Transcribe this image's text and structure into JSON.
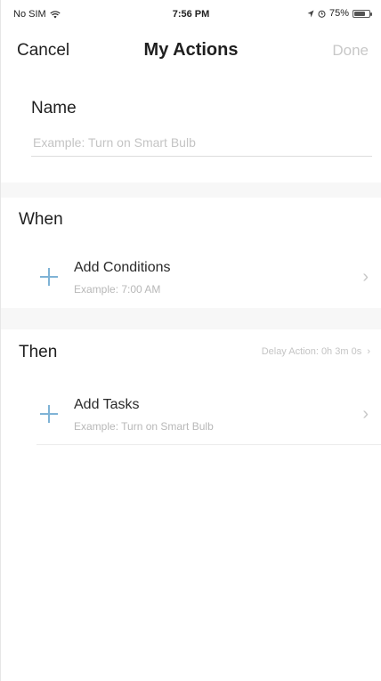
{
  "status_bar": {
    "carrier": "No SIM",
    "time": "7:56 PM",
    "battery_text": "75%",
    "battery_level": 0.75
  },
  "nav": {
    "cancel_label": "Cancel",
    "title": "My Actions",
    "done_label": "Done"
  },
  "name_section": {
    "label": "Name",
    "placeholder": "Example: Turn on Smart Bulb",
    "value": ""
  },
  "when_section": {
    "label": "When",
    "row": {
      "title": "Add Conditions",
      "subtitle": "Example: 7:00 AM"
    }
  },
  "then_section": {
    "label": "Then",
    "delay_action": "Delay Action: 0h 3m 0s",
    "row": {
      "title": "Add Tasks",
      "subtitle": "Example: Turn on Smart Bulb"
    }
  },
  "colors": {
    "accent_plus": "#7fb3d6",
    "done_disabled": "#c8c8c8",
    "section_gap": "#f7f7f7"
  }
}
